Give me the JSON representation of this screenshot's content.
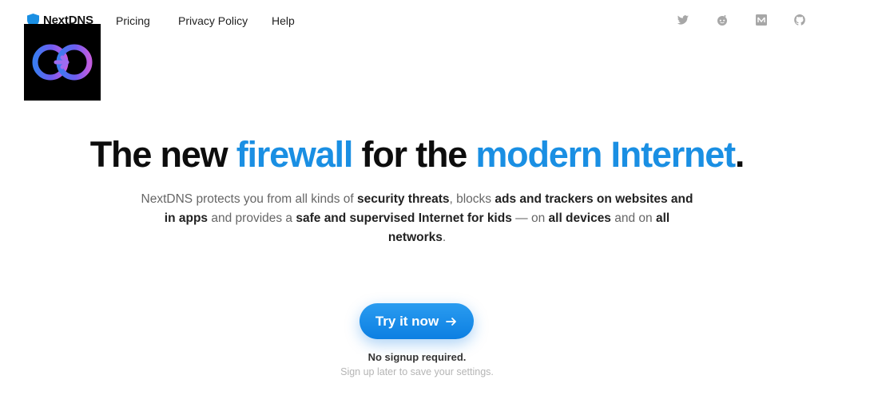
{
  "nav": {
    "brand": "NextDNS",
    "links": [
      "Pricing",
      "Privacy Policy",
      "Help"
    ],
    "social_icons": [
      "twitter-icon",
      "reddit-icon",
      "medium-icon",
      "github-icon"
    ]
  },
  "hero": {
    "headline": {
      "part1": "The new ",
      "part2": "firewall",
      "part3": " for the ",
      "part4": "modern Internet",
      "part5": "."
    },
    "lead": {
      "t1": "NextDNS protects you from all kinds of ",
      "b1": "security threats",
      "t2": ", blocks ",
      "b2": "ads and trackers on websites and in apps",
      "t3": " and provides a ",
      "b3": "safe and supervised Internet for kids",
      "t4": " — on ",
      "b4": "all devices",
      "t5": " and on ",
      "b5": "all networks",
      "t6": "."
    },
    "cta_label": "Try it now",
    "note_primary": "No signup required.",
    "note_secondary": "Sign up later to save your settings."
  },
  "colors": {
    "accent": "#1a8fe3",
    "cta": "#0c7fe2"
  }
}
